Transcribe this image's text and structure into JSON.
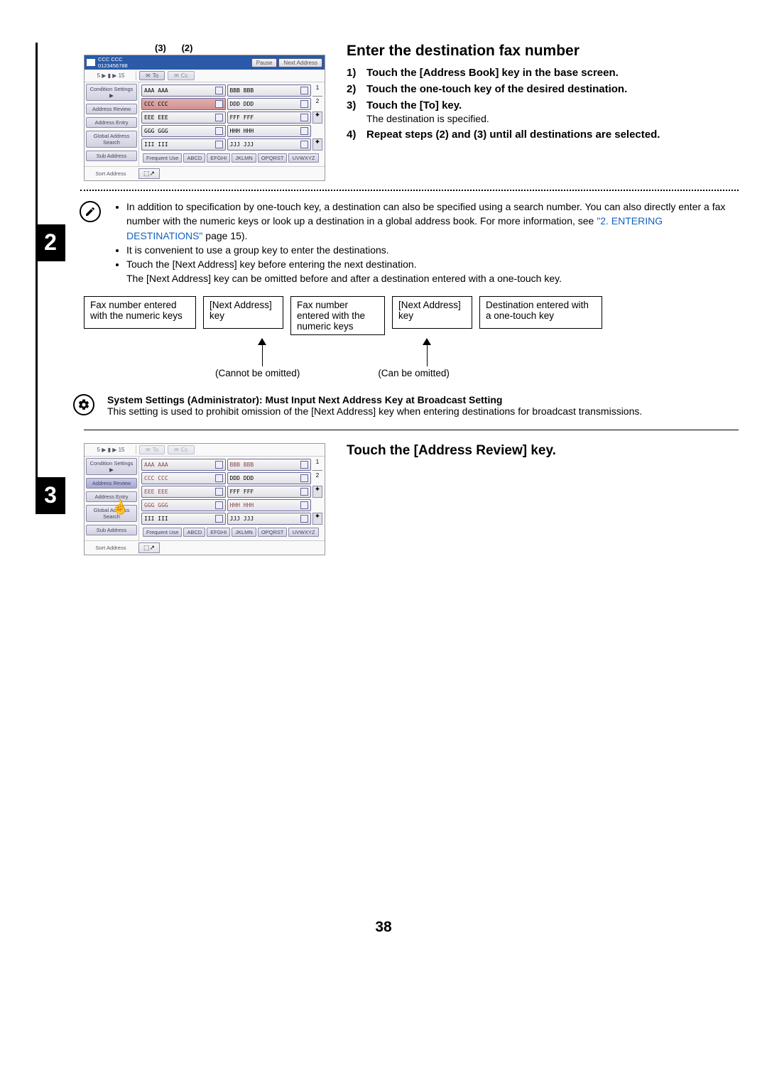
{
  "callouts": {
    "c3": "(3)",
    "c2": "(2)"
  },
  "screen1": {
    "header": {
      "line1": "CCC CCC",
      "line2": "0123456788",
      "pause": "Pause",
      "next": "Next Address"
    },
    "nav": {
      "crumb": "5 ▶ ▮ ▶ 15",
      "to": "To",
      "cc": "Cc"
    },
    "sidebar": [
      "Condition Settings ▶",
      "Address Review",
      "Address Entry",
      "Global Address Search",
      "Sub Address"
    ],
    "entries": [
      [
        "AAA AAA",
        "BBB BBB"
      ],
      [
        "CCC CCC",
        "DDD DDD"
      ],
      [
        "EEE EEE",
        "FFF FFF"
      ],
      [
        "GGG GGG",
        "HHH HHH"
      ],
      [
        "III III",
        "JJJ JJJ"
      ]
    ],
    "page": {
      "cur": "1",
      "total": "2"
    },
    "tabs": [
      "Frequent Use",
      "ABCD",
      "EFGHI",
      "JKLMN",
      "OPQRST",
      "UVWXYZ"
    ],
    "sort": "Sort Address"
  },
  "step2": {
    "heading": "Enter the destination fax number",
    "items": [
      {
        "n": "1)",
        "t": "Touch the [Address Book] key in the base screen."
      },
      {
        "n": "2)",
        "t": "Touch the one-touch key of the desired destination."
      },
      {
        "n": "3)",
        "t": "Touch the [To] key.",
        "sub": "The destination is specified."
      },
      {
        "n": "4)",
        "t": "Repeat steps (2) and (3) until all destinations are selected."
      }
    ],
    "notes": [
      "In addition to specification by one-touch key, a destination can also be specified using a search number. You can also directly enter a fax number with the numeric keys or look up a destination in a global address book. For more information, see ",
      "It is convenient to use a group key to enter the destinations.",
      "Touch the [Next Address] key before entering the next destination.",
      "The [Next Address] key can be omitted before and after a destination entered with a one-touch key."
    ],
    "notes_link": "\"2. ENTERING DESTINATIONS\"",
    "notes_link_after": " page 15).",
    "flow": [
      "Fax number entered with the numeric keys",
      "[Next Address] key",
      "Fax number entered with the numeric keys",
      "[Next Address] key",
      "Destination entered with a one-touch key"
    ],
    "flow_labels": {
      "a": "(Cannot be omitted)",
      "b": "(Can be omitted)"
    },
    "admin_title": "System Settings (Administrator): Must Input Next Address Key at Broadcast Setting",
    "admin_body": "This setting is used to prohibit omission of the [Next Address] key when entering destinations for broadcast transmissions."
  },
  "step3": {
    "heading": "Touch the [Address Review] key."
  },
  "step_numbers": {
    "s2": "2",
    "s3": "3"
  },
  "page_number": "38"
}
